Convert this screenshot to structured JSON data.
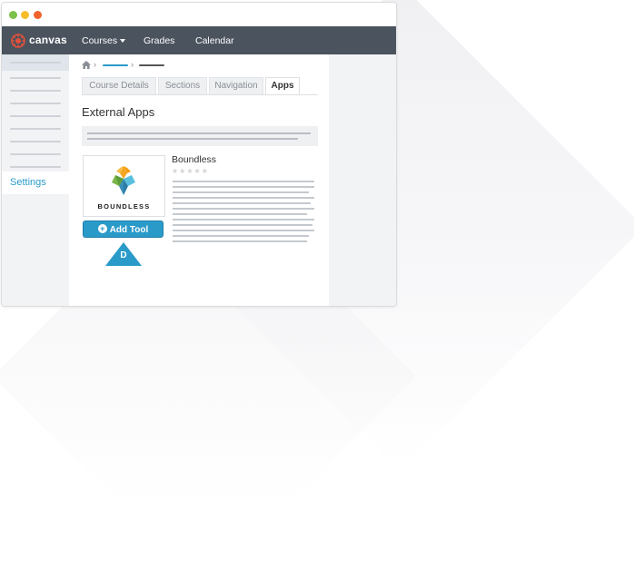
{
  "window": {
    "traffic_lights": {
      "green": "#7cc149",
      "yellow": "#f5bd2b",
      "red": "#f0642c"
    }
  },
  "navbar": {
    "brand": "canvas",
    "logo_icon": "canvas-logo-icon",
    "items": [
      {
        "label": "Courses",
        "has_dropdown": true
      },
      {
        "label": "Grades"
      },
      {
        "label": "Calendar"
      }
    ],
    "background": "#4b535e"
  },
  "sidebar": {
    "settings_label": "Settings",
    "accent": "#2a9ac9"
  },
  "breadcrumb": {
    "home_icon": "home-icon"
  },
  "tabs": [
    {
      "label": "Course Details",
      "active": false
    },
    {
      "label": "Sections",
      "active": false
    },
    {
      "label": "Navigation",
      "active": false
    },
    {
      "label": "Apps",
      "active": true
    }
  ],
  "main": {
    "section_title": "External Apps"
  },
  "app": {
    "name": "Boundless",
    "logo_text": "BOUNDLESS",
    "rating_stars": 5,
    "add_button_label": "Add Tool",
    "add_button_color": "#2a9ac9"
  },
  "marker": {
    "label": "D",
    "color": "#2a9ac9"
  }
}
